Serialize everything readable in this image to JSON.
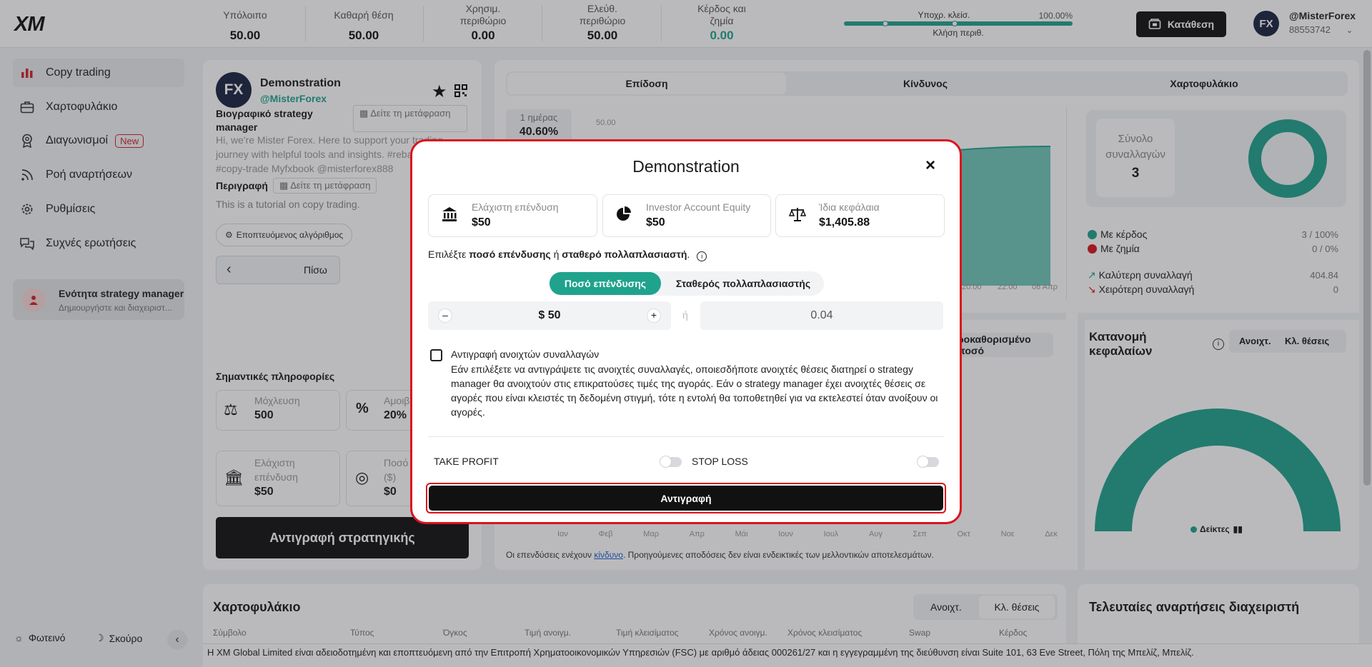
{
  "header": {
    "logo": "XM",
    "stats": [
      {
        "label": "Υπόλοιπο",
        "value": "50.00"
      },
      {
        "label": "Καθαρή θέση",
        "value": "50.00"
      },
      {
        "label": "Χρησιμ. περιθώριο",
        "value": "0.00"
      },
      {
        "label": "Ελεύθ. περιθώριο",
        "value": "50.00"
      },
      {
        "label": "Κέρδος και ζημία",
        "value": "0.00"
      }
    ],
    "margin_bar": {
      "left_label": "Υποχρ. κλείσ.",
      "right_label": "100.00%",
      "bottom_label": "Κλήση περιθ."
    },
    "deposit_label": "Κατάθεση",
    "user": {
      "name": "@MisterForex",
      "account": "88553742"
    }
  },
  "sidebar": {
    "items": [
      {
        "label": "Copy trading",
        "icon": "bar-chart-icon"
      },
      {
        "label": "Χαρτοφυλάκιο",
        "icon": "briefcase-icon"
      },
      {
        "label": "Διαγωνισμοί",
        "icon": "award-icon",
        "badge": "New"
      },
      {
        "label": "Ροή αναρτήσεων",
        "icon": "rss-icon"
      },
      {
        "label": "Ρυθμίσεις",
        "icon": "gear-icon"
      },
      {
        "label": "Συχνές ερωτήσεις",
        "icon": "chat-icon"
      }
    ],
    "promo": {
      "title": "Ενότητα strategy manager",
      "subtitle": "Δημιουργήστε και διαχειριστ..."
    },
    "theme_light": "Φωτεινό",
    "theme_dark": "Σκούρο"
  },
  "strategy": {
    "avatar_text": "FX",
    "name": "Demonstration",
    "handle": "@MisterForex",
    "bio_title": "Βιογραφικό strategy manager",
    "translate_label": "Δείτε τη μετάφραση",
    "bio": "Hi, we're Mister Forex. Here to support your trading journey with helpful tools and insights. #rebates #copy-trade Myfxbook @misterforex888",
    "description_label": "Περιγραφή",
    "description": "This is a tutorial on copy trading.",
    "algo_label": "Εποπτευόμενος αλγόριθμος",
    "back_label": "Πίσω",
    "important_info": "Σημαντικές πληροφορίες",
    "leverage_label": "Μόχλευση",
    "leverage_value": "500",
    "fee_label": "Αμοιβ",
    "fee_value": "20%",
    "min_inv_label": "Ελάχιστη επένδυση",
    "min_inv_value": "$50",
    "amount_label": "Ποσό ($)",
    "amount_value": "$0",
    "copy_strategy_label": "Αντιγραφή στρατηγικής"
  },
  "tabs": [
    "Επίδοση",
    "Κίνδυνος",
    "Χαρτοφυλάκιο"
  ],
  "performance": {
    "period_label": "1 ημέρας",
    "period_value": "40.60%",
    "y_tick": "50.00",
    "x_ticks": [
      "20:00",
      "22:00",
      "08 Απρ"
    ],
    "months": [
      "Ιαν",
      "Φεβ",
      "Μαρ",
      "Απρ",
      "Μάι",
      "Ιουν",
      "Ιουλ",
      "Αυγ",
      "Σεπ",
      "Οκτ",
      "Νοε",
      "Δεκ"
    ],
    "predefined_amount": "ροκαθορισμένο ποσό",
    "disclaimer_pre": "Οι επενδύσεις ενέχουν ",
    "disclaimer_link": "κίνδυνο",
    "disclaimer_post": ". Προηγούμενες αποδόσεις δεν είναι ενδεικτικές των μελλοντικών αποτελεσμάτων."
  },
  "trades_summary": {
    "total_label": "Σύνολο συναλλαγών",
    "total_value": "3",
    "profit_label": "Με κέρδος",
    "profit_value": "3 / 100%",
    "loss_label": "Με ζημία",
    "loss_value": "0 / 0%",
    "best_label": "Καλύτερη συναλλαγή",
    "best_value": "404.84",
    "worst_label": "Χειρότερη συναλλαγή",
    "worst_value": "0"
  },
  "allocation": {
    "title": "Κατανομή κεφαλαίων",
    "tab_open": "Ανοιχτ.",
    "tab_closed": "Κλ. θέσεις",
    "gauge_value": "100%",
    "legend": "Δείκτες"
  },
  "portfolio": {
    "title": "Χαρτοφυλάκιο",
    "tab_open": "Ανοιχτ.",
    "tab_closed": "Κλ. θέσεις",
    "columns": [
      "Σύμβολο",
      "Τύπος",
      "Όγκος",
      "Τιμή ανοιγμ.",
      "Τιμή κλεισίματος",
      "Χρόνος ανοιγμ.",
      "Χρόνος κλεισίματος",
      "Swap",
      "Κέρδος"
    ]
  },
  "posts": {
    "title": "Τελευταίες αναρτήσεις διαχειριστή"
  },
  "footer": "Η XM Global Limited είναι αδειοδοτημένη και εποπτευόμενη από την Επιτροπή Χρηματοοικονομικών Υπηρεσιών (FSC) με αριθμό άδειας 000261/27 και η εγγεγραμμένη της διεύθυνση είναι Suite 101, 63 Eve Street, Πόλη της Μπελίζ, Μπελίζ.",
  "modal": {
    "title": "Demonstration",
    "fields": [
      {
        "label": "Ελάχιστη επένδυση",
        "value": "$50",
        "icon": "bank-icon"
      },
      {
        "label": "Investor Account Equity",
        "value": "$50",
        "icon": "pie-chart-icon"
      },
      {
        "label": "Ίδια κεφάλαια",
        "value": "$1,405.88",
        "icon": "scale-icon"
      }
    ],
    "choose_pre": "Επιλέξτε ",
    "choose_bold1": "ποσό επένδυσης",
    "choose_mid": " ή ",
    "choose_bold2": "σταθερό πολλαπλασιαστή",
    "choose_post": ".",
    "mode_amount": "Ποσό επένδυσης",
    "mode_multiplier": "Σταθερός πολλαπλασιαστής",
    "amount_value": "$ 50",
    "or_label": "ή",
    "multiplier_value": "0.04",
    "copy_open_title": "Αντιγραφή ανοιχτών συναλλαγών",
    "copy_open_text": "Εάν επιλέξετε να αντιγράψετε τις ανοιχτές συναλλαγές, οποιεσδήποτε ανοιχτές θέσεις διατηρεί ο strategy manager θα ανοιχτούν στις επικρατούσες τιμές της αγοράς. Εάν ο strategy manager έχει ανοιχτές θέσεις σε αγορές που είναι κλειστές τη δεδομένη στιγμή, τότε η εντολή θα τοποθετηθεί για να εκτελεστεί όταν ανοίξουν οι αγορές.",
    "take_profit": "TAKE PROFIT",
    "stop_loss": "STOP LOSS",
    "copy_button": "Αντιγραφή",
    "close_label": "×"
  },
  "colors": {
    "accent": "#1fa38d",
    "danger": "#d9141d",
    "dark": "#111111"
  }
}
